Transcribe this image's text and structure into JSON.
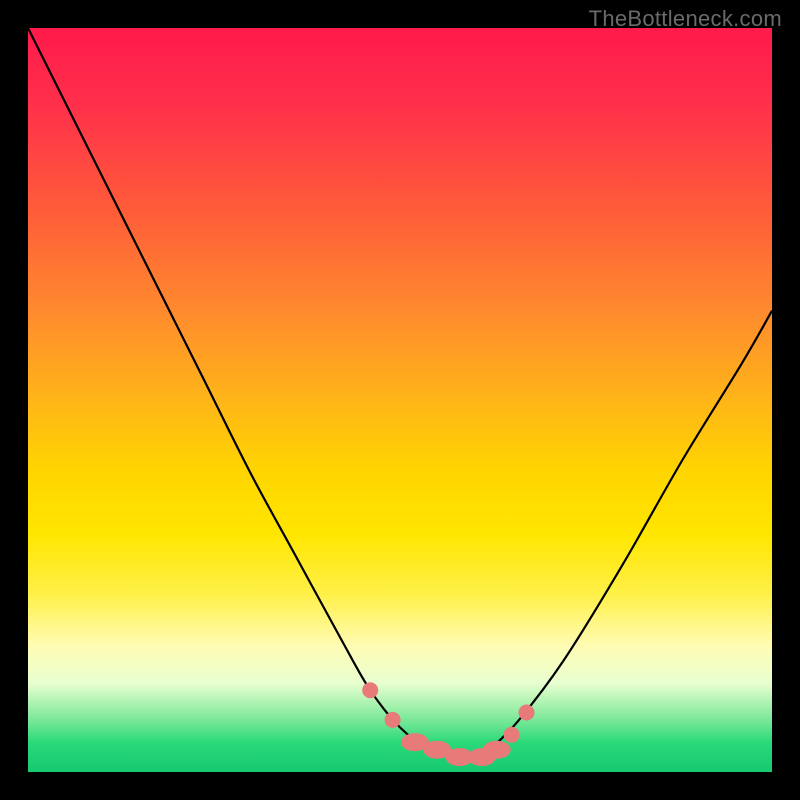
{
  "watermark": "TheBottleneck.com",
  "colors": {
    "background": "#000000",
    "curve": "#000000",
    "marker": "#e87a7a",
    "gradient_top": "#ff1a4b",
    "gradient_bottom": "#16c96f"
  },
  "chart_data": {
    "type": "line",
    "title": "",
    "xlabel": "",
    "ylabel": "",
    "xlim": [
      0,
      100
    ],
    "ylim": [
      0,
      100
    ],
    "grid": false,
    "legend": false,
    "series": [
      {
        "name": "bottleneck-curve",
        "x": [
          0,
          6,
          12,
          18,
          24,
          30,
          36,
          42,
          46,
          50,
          54,
          58,
          60,
          62,
          66,
          72,
          80,
          88,
          96,
          100
        ],
        "values": [
          100,
          88,
          76,
          64,
          52,
          40,
          29,
          18,
          11,
          6,
          3,
          2,
          2,
          3,
          7,
          15,
          28,
          42,
          55,
          62
        ]
      }
    ],
    "markers": {
      "x": [
        46,
        49,
        52,
        55,
        58,
        61,
        63,
        65,
        67
      ],
      "values": [
        11,
        7,
        4,
        3,
        2,
        2,
        3,
        5,
        8
      ],
      "shape": "circle"
    }
  }
}
